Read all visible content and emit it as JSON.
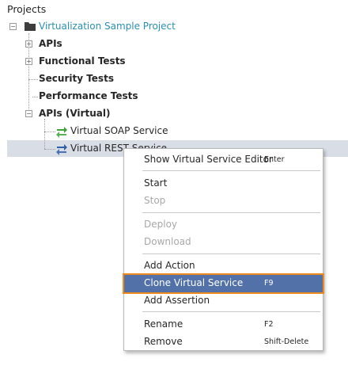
{
  "tree": {
    "header": "Projects",
    "project": "Virtualization Sample Project",
    "nodes": {
      "apis": "APIs",
      "functional": "Functional Tests",
      "security": "Security Tests",
      "performance": "Performance Tests",
      "apis_virtual": "APIs (Virtual)",
      "soap": "Virtual SOAP Service",
      "rest": "Virtual REST Service"
    },
    "expanders": {
      "collapse": "−",
      "expand": "+"
    }
  },
  "menu": {
    "show_editor": {
      "label": "Show Virtual Service Editor",
      "shortcut": "Enter"
    },
    "start": {
      "label": "Start"
    },
    "stop": {
      "label": "Stop"
    },
    "deploy": {
      "label": "Deploy"
    },
    "download": {
      "label": "Download"
    },
    "add_action": {
      "label": "Add Action"
    },
    "clone": {
      "label": "Clone Virtual Service",
      "shortcut": "F9"
    },
    "add_assertion": {
      "label": "Add Assertion"
    },
    "rename": {
      "label": "Rename",
      "shortcut": "F2"
    },
    "remove": {
      "label": "Remove",
      "shortcut": "Shift-Delete"
    }
  },
  "colors": {
    "project_text": "#2b8fb0",
    "highlight_bg": "#5271a8",
    "highlight_border": "#ef8a1e",
    "selection_bg": "#d9dde6",
    "soap_arrow": "#3aa535",
    "rest_arrow": "#2f5fa8"
  }
}
